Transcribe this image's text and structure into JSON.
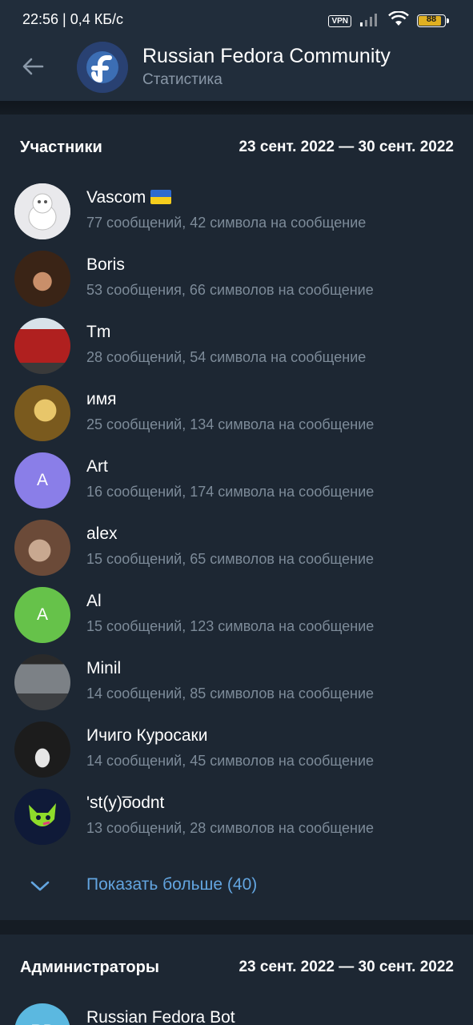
{
  "status_bar": {
    "time": "22:56 | 0,4 КБ/с",
    "vpn": "VPN",
    "battery": "88"
  },
  "header": {
    "title": "Russian Fedora Community",
    "subtitle": "Статистика"
  },
  "members_section": {
    "title": "Участники",
    "date_range": "23 сент. 2022 — 30 сент. 2022",
    "members": [
      {
        "name": "Vascom",
        "stats": "77 сообщений, 42 символа на сообщение",
        "avatar_color": "#e9e9ec"
      },
      {
        "name": "Boris",
        "stats": "53 сообщения, 66 символов на сообщение",
        "avatar_color": "#4a2c20"
      },
      {
        "name": "Tm",
        "stats": "28 сообщений, 54 символа на сообщение",
        "avatar_color": "#b0201f"
      },
      {
        "name": "имя",
        "stats": "25 сообщений, 134 символа на сообщение",
        "avatar_color": "#7a5a1e"
      },
      {
        "name": "Art",
        "stats": "16 сообщений, 174 символа на сообщение",
        "avatar_color": "#8a7ee8",
        "initial": "A"
      },
      {
        "name": "alex",
        "stats": "15 сообщений, 65 символов на сообщение",
        "avatar_color": "#8a6048"
      },
      {
        "name": "Al",
        "stats": "15 сообщений, 123 символа на сообщение",
        "avatar_color": "#66c24a",
        "initial": "A"
      },
      {
        "name": "Minil",
        "stats": "14 сообщений, 85 символов на сообщение",
        "avatar_color": "#5b5e62"
      },
      {
        "name": "Ичиго Куросаки",
        "stats": "14 сообщений, 45 символов на сообщение",
        "avatar_color": "#1c1c1c"
      },
      {
        "name": "'st(y)o̅odnt",
        "stats": "13 сообщений, 28 символов на сообщение",
        "avatar_color": "#0f1a38"
      }
    ],
    "show_more": "Показать больше (40)"
  },
  "admins_section": {
    "title": "Администраторы",
    "date_range": "23 сент. 2022 — 30 сент. 2022",
    "first_admin": {
      "name": "Russian Fedora Bot",
      "initial": "RB",
      "avatar_color": "#5bb8e0"
    }
  },
  "colors": {
    "background": "#151c24",
    "section_bg": "#1d2733",
    "header_bg": "#212d3b",
    "accent_link": "#63a5e0",
    "secondary_text": "#7d8b99"
  }
}
